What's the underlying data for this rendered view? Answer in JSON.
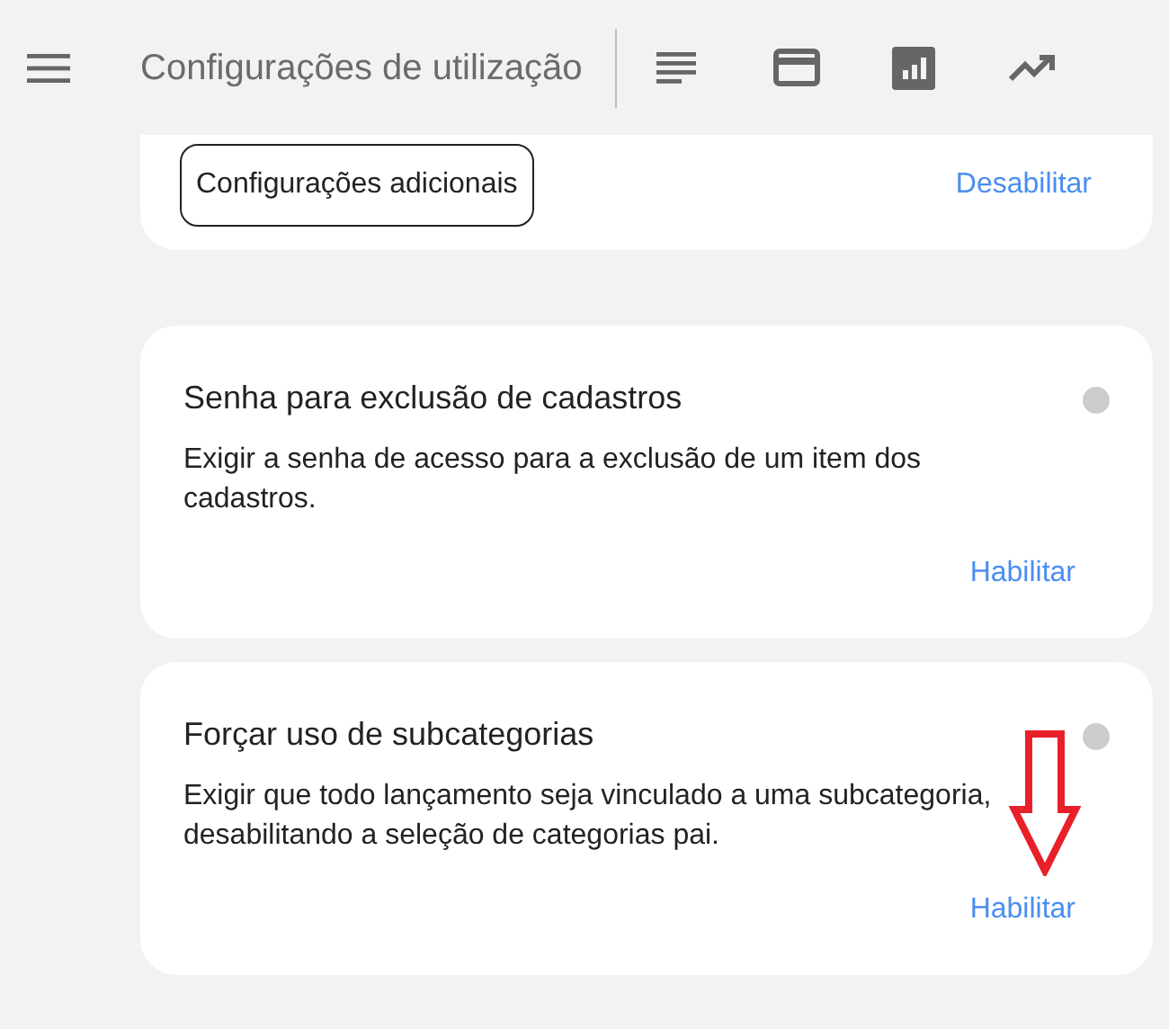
{
  "header": {
    "title": "Configurações de utilização"
  },
  "cards": [
    {
      "kind": "options",
      "button": "Configurações adicionais",
      "action": "Desabilitar"
    },
    {
      "kind": "setting",
      "title": "Senha para exclusão de cadastros",
      "description": "Exigir a senha de acesso para a exclusão de um item dos cadastros.",
      "enabled": false,
      "action": "Habilitar"
    },
    {
      "kind": "setting",
      "title": "Forçar uso de subcategorias",
      "description": "Exigir que todo lançamento seja vinculado a uma subcategoria, desabilitando a seleção de categorias pai.",
      "enabled": false,
      "action": "Habilitar"
    }
  ]
}
